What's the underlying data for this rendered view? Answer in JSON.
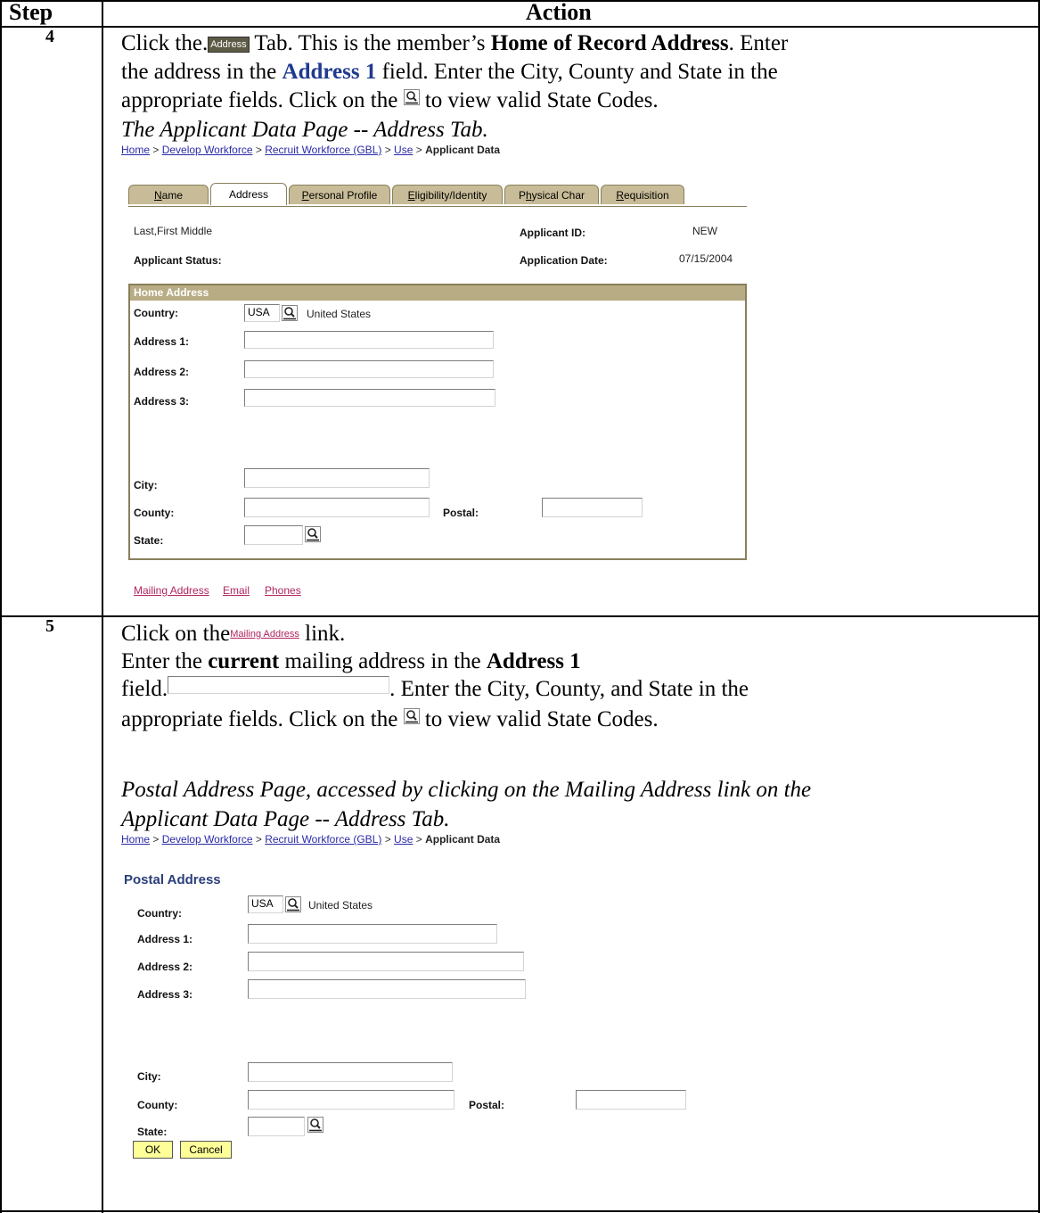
{
  "table": {
    "col_step": "Step",
    "col_action": "Action"
  },
  "step4": {
    "number": "4",
    "line1_a": "Click the.",
    "tab_icon_label": "Address",
    "line1_b": " Tab.  This is the member’s ",
    "line1_bold": "Home of Record Address",
    "line1_c": ".  Enter",
    "line2_a": "the address in the ",
    "line2_blue": "Address 1",
    "line2_b": " field.  Enter the City, County and State in the",
    "line3_a": "appropriate fields.  Click on the ",
    "line3_b": " to view valid State Codes.",
    "caption": "The Applicant Data Page -- Address Tab.",
    "screenshot": {
      "breadcrumb": {
        "home": "Home",
        "sep": " > ",
        "develop": "Develop Workforce",
        "recruit": "Recruit Workforce (GBL)",
        "use": "Use",
        "current": "Applicant Data"
      },
      "tabs": [
        {
          "pre": "",
          "u": "N",
          "post": "ame"
        },
        {
          "pre": "Address",
          "u": "",
          "post": ""
        },
        {
          "pre": "",
          "u": "P",
          "post": "ersonal Profile"
        },
        {
          "pre": "",
          "u": "E",
          "post": "ligibility/Identity"
        },
        {
          "pre": "P",
          "u": "h",
          "post": "ysical Char"
        },
        {
          "pre": "",
          "u": "R",
          "post": "equisition"
        }
      ],
      "name_value": "Last,First Middle",
      "applicant_id_label": "Applicant ID:",
      "applicant_id_value": "NEW",
      "applicant_status_label": "Applicant Status:",
      "application_date_label": "Application Date:",
      "application_date_value": "07/15/2004",
      "section_title": "Home Address",
      "country_label": "Country:",
      "country_value": "USA",
      "country_desc": "United States",
      "address1_label": "Address 1:",
      "address2_label": "Address 2:",
      "address3_label": "Address 3:",
      "city_label": "City:",
      "county_label": "County:",
      "postal_label": "Postal:",
      "state_label": "State:",
      "links": [
        "Mailing Address",
        "Email",
        "Phones"
      ]
    }
  },
  "step5": {
    "number": "5",
    "line1_a": "Click on the",
    "link_icon": "Mailing Address",
    "line1_b": " link.",
    "line2_a": "Enter the ",
    "line2_bold1": "current",
    "line2_b": " mailing address in the ",
    "line2_bold2": "Address 1",
    "line3_a": "field.",
    "line3_b": ".  Enter the City, County, and State in the",
    "line4_a": "appropriate fields.  Click on the ",
    "line4_b": " to view valid State Codes.",
    "caption1": "Postal Address Page, accessed by clicking on the Mailing Address link on the",
    "caption2": "Applicant Data Page -- Address Tab.",
    "screenshot": {
      "breadcrumb": {
        "home": "Home",
        "sep": " > ",
        "develop": "Develop Workforce",
        "recruit": "Recruit Workforce (GBL)",
        "use": "Use",
        "current": "Applicant Data"
      },
      "page_title": "Postal Address",
      "country_label": "Country:",
      "country_value": "USA",
      "country_desc": "United States",
      "address1_label": "Address 1:",
      "address2_label": "Address 2:",
      "address3_label": "Address 3:",
      "city_label": "City:",
      "county_label": "County:",
      "postal_label": "Postal:",
      "state_label": "State:",
      "ok_label": "OK",
      "cancel_label": "Cancel"
    }
  }
}
